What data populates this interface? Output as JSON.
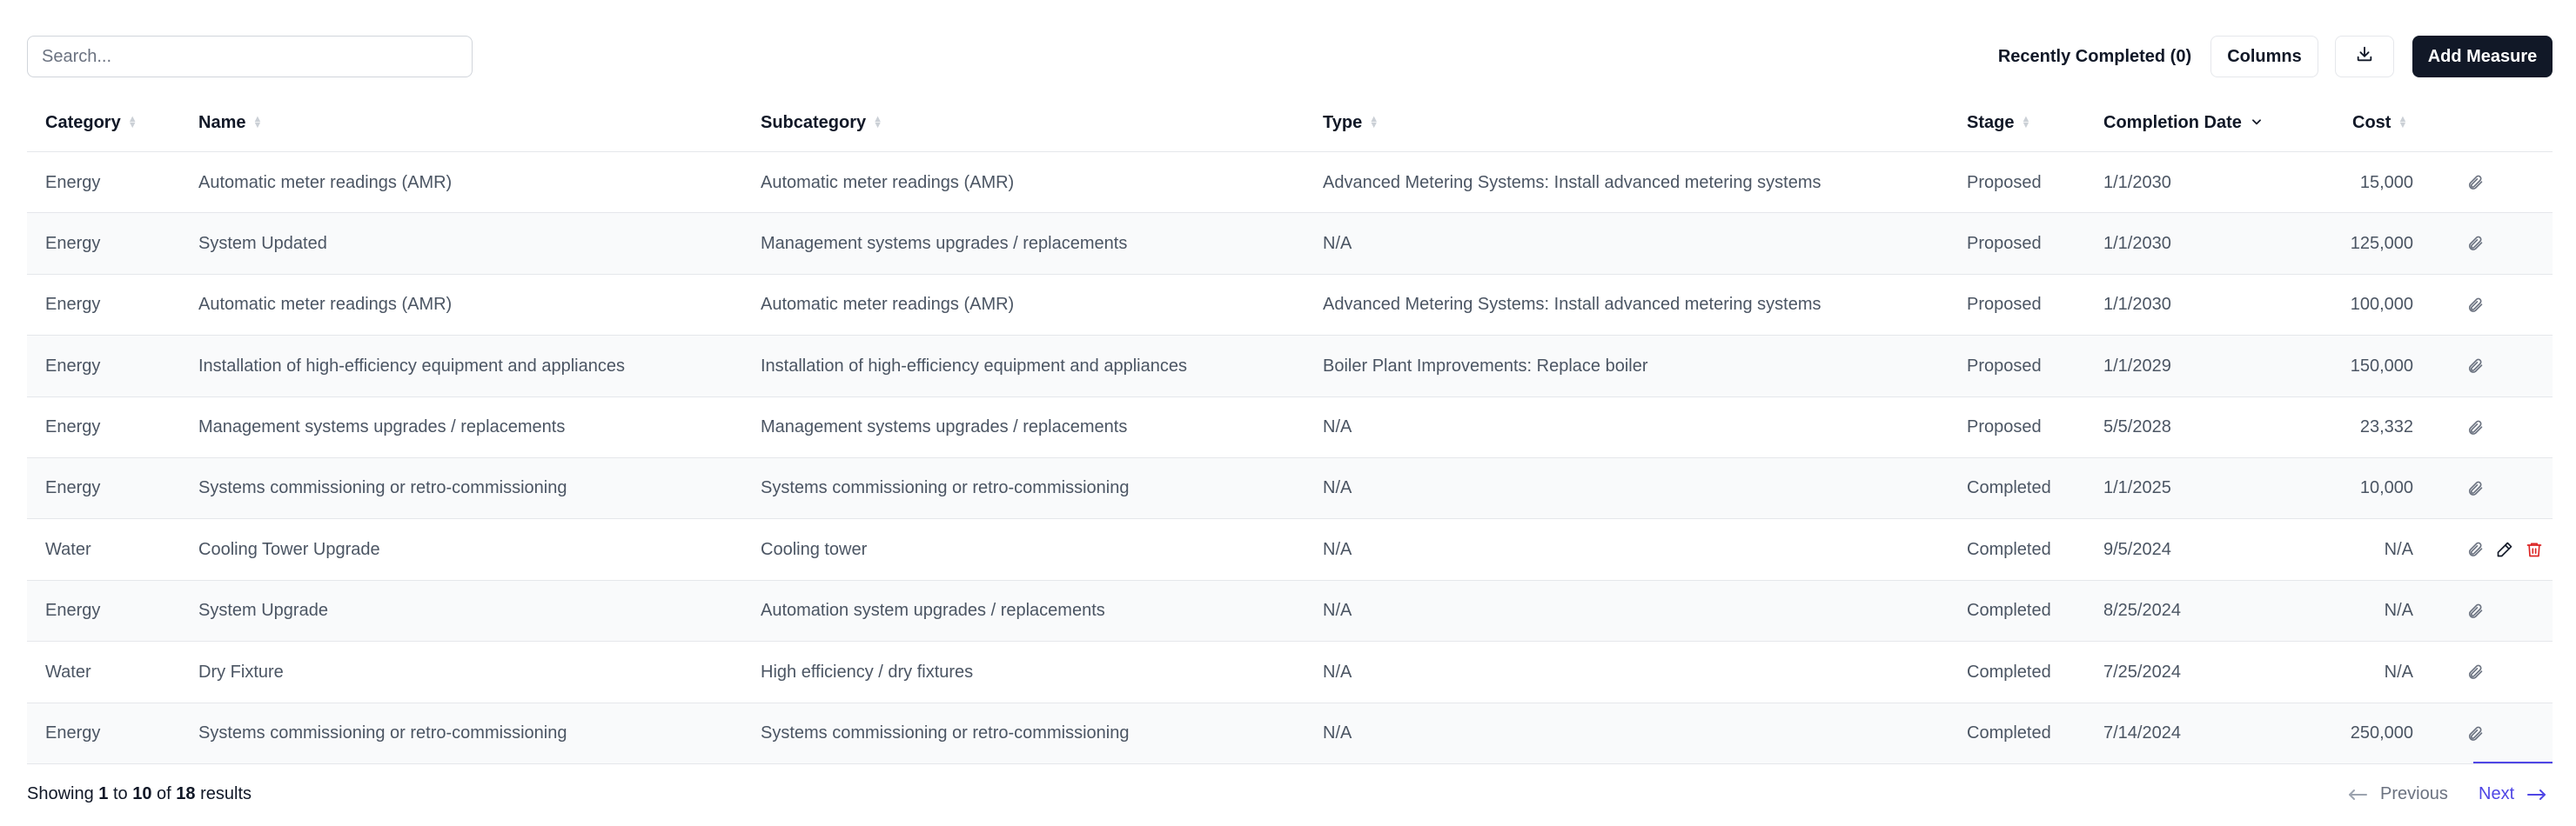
{
  "search": {
    "placeholder": "Search..."
  },
  "toolbar": {
    "recent_label": "Recently Completed (0)",
    "columns_label": "Columns",
    "download_icon": "download-icon",
    "add_label": "Add Measure"
  },
  "table": {
    "headers": {
      "category": "Category",
      "name": "Name",
      "subcategory": "Subcategory",
      "type": "Type",
      "stage": "Stage",
      "completion_date": "Completion Date",
      "cost": "Cost"
    },
    "sorted_column": "completion_date",
    "sort_direction": "descending",
    "rows": [
      {
        "category": "Energy",
        "name": "Automatic meter readings (AMR)",
        "subcategory": "Automatic meter readings (AMR)",
        "type": "Advanced Metering Systems: Install advanced metering systems",
        "stage": "Proposed",
        "date": "1/1/2030",
        "cost": "15,000"
      },
      {
        "category": "Energy",
        "name": "System Updated",
        "subcategory": "Management systems upgrades / replacements",
        "type": "N/A",
        "stage": "Proposed",
        "date": "1/1/2030",
        "cost": "125,000"
      },
      {
        "category": "Energy",
        "name": "Automatic meter readings (AMR)",
        "subcategory": "Automatic meter readings (AMR)",
        "type": "Advanced Metering Systems: Install advanced metering systems",
        "stage": "Proposed",
        "date": "1/1/2030",
        "cost": "100,000"
      },
      {
        "category": "Energy",
        "name": "Installation of high-efficiency equipment and appliances",
        "subcategory": "Installation of high-efficiency equipment and appliances",
        "type": "Boiler Plant Improvements: Replace boiler",
        "stage": "Proposed",
        "date": "1/1/2029",
        "cost": "150,000"
      },
      {
        "category": "Energy",
        "name": "Management systems upgrades / replacements",
        "subcategory": "Management systems upgrades / replacements",
        "type": "N/A",
        "stage": "Proposed",
        "date": "5/5/2028",
        "cost": "23,332"
      },
      {
        "category": "Energy",
        "name": "Systems commissioning or retro-commissioning",
        "subcategory": "Systems commissioning or retro-commissioning",
        "type": "N/A",
        "stage": "Completed",
        "date": "1/1/2025",
        "cost": "10,000"
      },
      {
        "category": "Water",
        "name": "Cooling Tower Upgrade",
        "subcategory": "Cooling tower",
        "type": "N/A",
        "stage": "Completed",
        "date": "9/5/2024",
        "cost": "N/A"
      },
      {
        "category": "Energy",
        "name": "System Upgrade",
        "subcategory": "Automation system upgrades / replacements",
        "type": "N/A",
        "stage": "Completed",
        "date": "8/25/2024",
        "cost": "N/A"
      },
      {
        "category": "Water",
        "name": "Dry Fixture",
        "subcategory": "High efficiency / dry fixtures",
        "type": "N/A",
        "stage": "Completed",
        "date": "7/25/2024",
        "cost": "N/A"
      },
      {
        "category": "Energy",
        "name": "Systems commissioning or retro-commissioning",
        "subcategory": "Systems commissioning or retro-commissioning",
        "type": "N/A",
        "stage": "Completed",
        "date": "7/14/2024",
        "cost": "250,000"
      }
    ],
    "row_actions": [
      "attachment-icon"
    ],
    "hover_row_actions": [
      "attachment-icon",
      "edit-icon",
      "delete-icon"
    ],
    "hover_row_index": 6
  },
  "footer": {
    "showing": "Showing",
    "from": "1",
    "to_word": "to",
    "to": "10",
    "of_word": "of",
    "total": "18",
    "results": "results"
  },
  "pagination": {
    "previous": "Previous",
    "next": "Next"
  },
  "colors": {
    "primary_dark": "#111827",
    "link": "#4f46e5",
    "danger": "#dc2626",
    "zebra": "#f9fafb"
  }
}
